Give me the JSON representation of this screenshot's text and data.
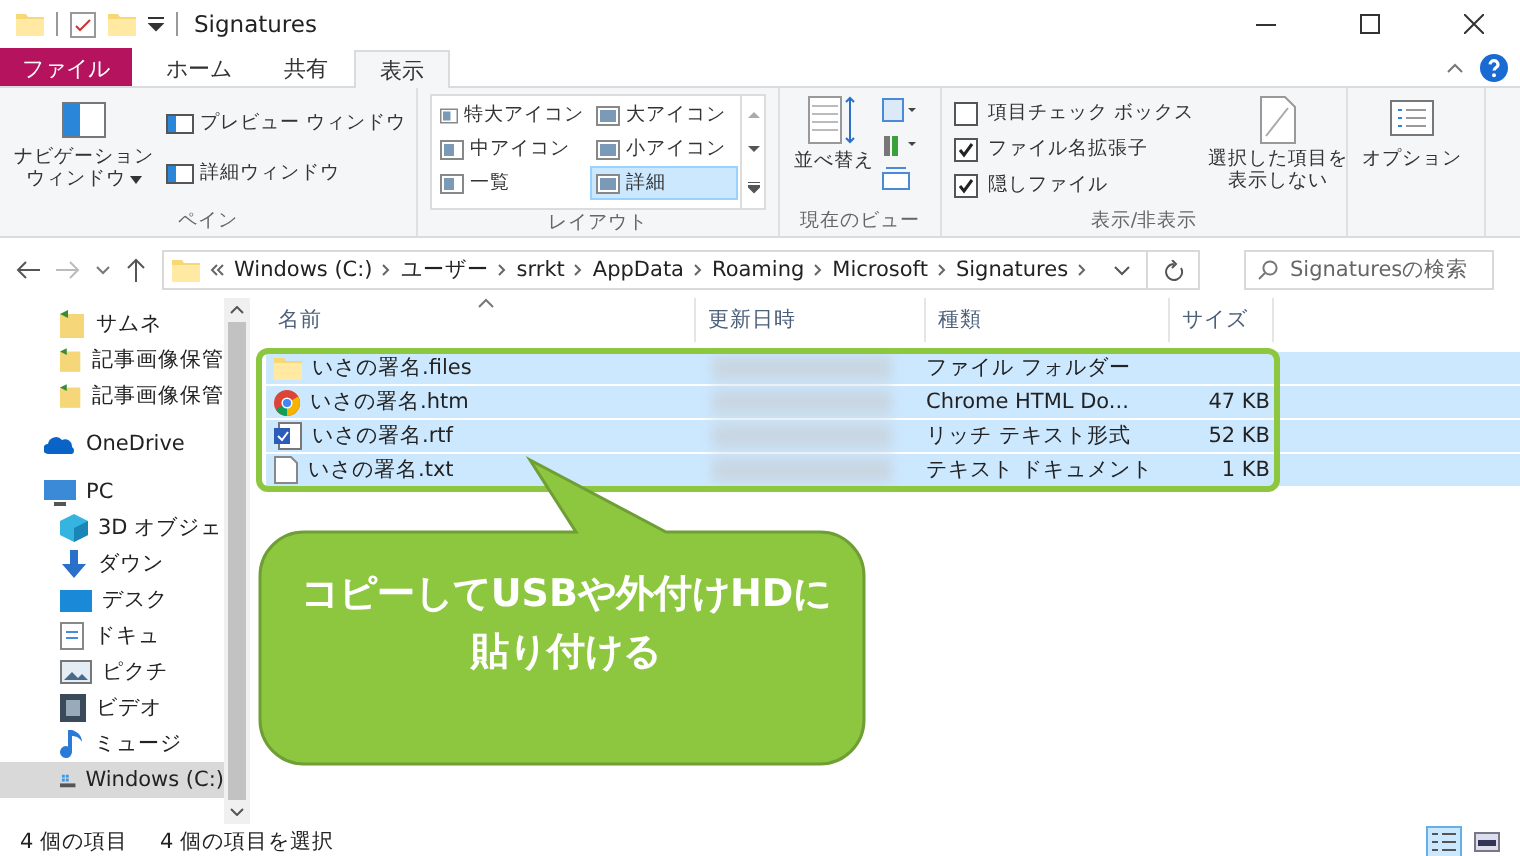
{
  "window": {
    "title": "Signatures"
  },
  "ribbon_tabs": [
    {
      "label": "ファイル",
      "kind": "file",
      "selected": false
    },
    {
      "label": "ホーム",
      "kind": "tab",
      "selected": false
    },
    {
      "label": "共有",
      "kind": "tab",
      "selected": false
    },
    {
      "label": "表示",
      "kind": "tab",
      "selected": true
    }
  ],
  "pane_group": {
    "title": "ペイン",
    "nav_pane_button": [
      "ナビゲーション",
      "ウィンドウ"
    ],
    "preview_pane": "プレビュー ウィンドウ",
    "details_pane": "詳細ウィンドウ"
  },
  "layout_group": {
    "title": "レイアウト",
    "items": [
      {
        "label": "特大アイコン",
        "selected": false
      },
      {
        "label": "大アイコン",
        "selected": false
      },
      {
        "label": "中アイコン",
        "selected": false
      },
      {
        "label": "小アイコン",
        "selected": false
      },
      {
        "label": "一覧",
        "selected": false
      },
      {
        "label": "詳細",
        "selected": true
      }
    ]
  },
  "current_view_group": {
    "title": "現在のビュー",
    "sort_button": "並べ替え"
  },
  "show_hide_group": {
    "title": "表示/非表示",
    "checkboxes": [
      {
        "label": "項目チェック ボックス",
        "checked": false
      },
      {
        "label": "ファイル名拡張子",
        "checked": true
      },
      {
        "label": "隠しファイル",
        "checked": true
      }
    ],
    "hide_selected_button": [
      "選択した項目を",
      "表示しない"
    ]
  },
  "options_button": "オプション",
  "address_bar": {
    "segments": [
      "Windows (C:)",
      "ユーザー",
      "srrkt",
      "AppData",
      "Roaming",
      "Microsoft",
      "Signatures"
    ]
  },
  "search": {
    "placeholder": "Signaturesの検索"
  },
  "nav_pane": {
    "pinned": [
      {
        "label": "サムネ",
        "selected": false
      },
      {
        "label": "記事画像保管",
        "selected": false
      },
      {
        "label": "記事画像保管",
        "selected": false
      }
    ],
    "tree": [
      {
        "label": "OneDrive",
        "kind": "cloud",
        "selected": false
      },
      {
        "label": "PC",
        "kind": "pc",
        "selected": false,
        "children": [
          {
            "label": "3D オブジェ",
            "kind": "cube",
            "selected": false
          },
          {
            "label": "ダウン",
            "kind": "download",
            "selected": false
          },
          {
            "label": "デスク",
            "kind": "desktop",
            "selected": false
          },
          {
            "label": "ドキュ",
            "kind": "document",
            "selected": false
          },
          {
            "label": "ピクチ",
            "kind": "pictures",
            "selected": false
          },
          {
            "label": "ビデオ",
            "kind": "video",
            "selected": false
          },
          {
            "label": "ミュージ",
            "kind": "music",
            "selected": false
          },
          {
            "label": "Windows (C:)",
            "kind": "drive",
            "selected": true
          }
        ]
      }
    ]
  },
  "file_list": {
    "columns": [
      "名前",
      "更新日時",
      "種類",
      "サイズ"
    ],
    "rows": [
      {
        "name": "いさの署名.files",
        "kind": "folder",
        "type": "ファイル フォルダー",
        "selected": true
      },
      {
        "name": "いさの署名.htm",
        "kind": "chrome",
        "type": "Chrome HTML Do...",
        "size": "47 KB",
        "selected": true
      },
      {
        "name": "いさの署名.rtf",
        "kind": "rtf",
        "type": "リッチ テキスト形式",
        "size": "52 KB",
        "selected": true
      },
      {
        "name": "いさの署名.txt",
        "kind": "txt",
        "type": "テキスト ドキュメント",
        "size": "1 KB",
        "selected": true
      }
    ]
  },
  "callout": {
    "lines": [
      "コピーしてUSBや外付けHDに",
      "貼り付ける"
    ]
  },
  "status_bar": {
    "item_count": "4 個の項目",
    "selection": "4 個の項目を選択",
    "view_buttons": [
      {
        "kind": "details",
        "selected": true
      },
      {
        "kind": "thumbnails",
        "selected": false
      }
    ]
  }
}
